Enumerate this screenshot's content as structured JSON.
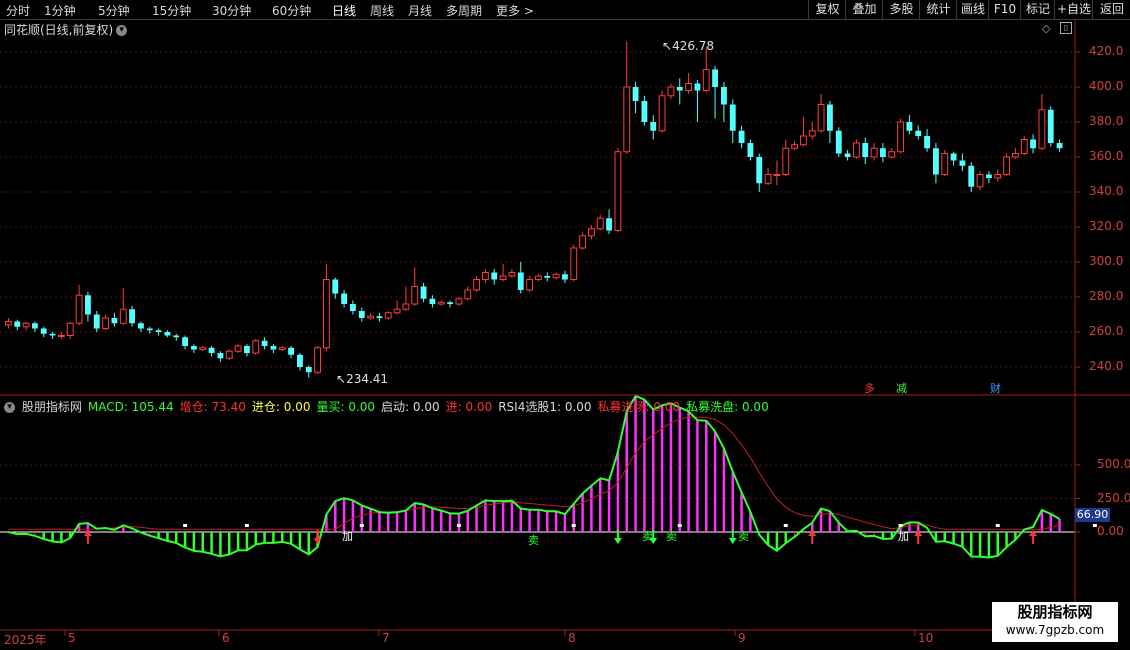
{
  "toolbar": {
    "left": [
      "分时",
      "1分钟",
      "5分钟",
      "15分钟",
      "30分钟",
      "60分钟",
      "日线",
      "周线",
      "月线",
      "多周期",
      "更多"
    ],
    "active": "日线",
    "right": [
      "复权",
      "叠加",
      "多股",
      "统计",
      "画线",
      "F10",
      "标记",
      "+自选",
      "返回"
    ]
  },
  "kchart": {
    "title": "同花顺(日线,前复权)",
    "high_label": "426.78",
    "low_label": "234.41",
    "y_ticks": [
      "420.0",
      "400.0",
      "380.0",
      "360.0",
      "340.0",
      "320.0",
      "300.0",
      "280.0",
      "260.0",
      "240.0"
    ],
    "tags": [
      {
        "text": "多",
        "color": "#ff3030"
      },
      {
        "text": "减",
        "color": "#30ff30"
      },
      {
        "text": "财",
        "color": "#30a0ff"
      }
    ],
    "candles": [
      [
        264,
        266,
        262,
        268
      ],
      [
        266,
        263,
        261,
        267
      ],
      [
        263,
        265,
        261,
        266
      ],
      [
        265,
        262,
        260,
        266
      ],
      [
        262,
        259,
        257,
        263
      ],
      [
        259,
        258,
        256,
        260
      ],
      [
        258,
        258,
        256,
        260
      ],
      [
        258,
        265,
        256,
        266
      ],
      [
        265,
        281,
        264,
        287
      ],
      [
        281,
        270,
        266,
        283
      ],
      [
        270,
        262,
        260,
        272
      ],
      [
        262,
        268,
        261,
        270
      ],
      [
        268,
        265,
        263,
        271
      ],
      [
        265,
        273,
        264,
        285
      ],
      [
        273,
        265,
        263,
        275
      ],
      [
        265,
        262,
        260,
        266
      ],
      [
        262,
        261,
        259,
        263
      ],
      [
        261,
        260,
        258,
        262
      ],
      [
        260,
        258,
        257,
        261
      ],
      [
        258,
        257,
        255,
        259
      ],
      [
        257,
        252,
        250,
        258
      ],
      [
        252,
        250,
        248,
        253
      ],
      [
        250,
        251,
        249,
        252
      ],
      [
        251,
        248,
        246,
        252
      ],
      [
        248,
        245,
        243,
        249
      ],
      [
        245,
        249,
        244,
        250
      ],
      [
        249,
        252,
        248,
        253
      ],
      [
        252,
        248,
        246,
        253
      ],
      [
        248,
        255,
        247,
        256
      ],
      [
        255,
        252,
        250,
        257
      ],
      [
        252,
        250,
        248,
        253
      ],
      [
        250,
        251,
        249,
        252
      ],
      [
        251,
        247,
        245,
        252
      ],
      [
        247,
        240,
        238,
        248
      ],
      [
        240,
        237,
        234,
        241
      ],
      [
        237,
        251,
        236,
        252
      ],
      [
        251,
        290,
        249,
        299
      ],
      [
        290,
        282,
        279,
        291
      ],
      [
        282,
        276,
        274,
        284
      ],
      [
        276,
        272,
        270,
        278
      ],
      [
        272,
        268,
        266,
        274
      ],
      [
        268,
        269,
        267,
        271
      ],
      [
        269,
        268,
        266,
        271
      ],
      [
        268,
        271,
        267,
        272
      ],
      [
        271,
        273,
        270,
        278
      ],
      [
        273,
        276,
        272,
        286
      ],
      [
        276,
        286,
        275,
        297
      ],
      [
        286,
        279,
        277,
        288
      ],
      [
        279,
        276,
        274,
        281
      ],
      [
        276,
        277,
        275,
        278
      ],
      [
        277,
        276,
        274,
        278
      ],
      [
        276,
        279,
        275,
        280
      ],
      [
        279,
        284,
        278,
        286
      ],
      [
        284,
        290,
        283,
        292
      ],
      [
        290,
        294,
        288,
        296
      ],
      [
        294,
        290,
        287,
        296
      ],
      [
        290,
        292,
        289,
        299
      ],
      [
        292,
        294,
        291,
        296
      ],
      [
        294,
        284,
        282,
        300
      ],
      [
        284,
        290,
        283,
        292
      ],
      [
        290,
        292,
        289,
        293
      ],
      [
        292,
        291,
        289,
        294
      ],
      [
        291,
        293,
        290,
        294
      ],
      [
        293,
        290,
        288,
        295
      ],
      [
        290,
        308,
        289,
        310
      ],
      [
        308,
        315,
        307,
        317
      ],
      [
        315,
        319,
        313,
        321
      ],
      [
        319,
        325,
        318,
        327
      ],
      [
        325,
        318,
        316,
        330
      ],
      [
        318,
        363,
        317,
        365
      ],
      [
        363,
        400,
        362,
        426
      ],
      [
        400,
        392,
        385,
        403
      ],
      [
        392,
        380,
        378,
        395
      ],
      [
        380,
        375,
        370,
        384
      ],
      [
        375,
        395,
        374,
        398
      ],
      [
        395,
        400,
        393,
        402
      ],
      [
        400,
        398,
        390,
        405
      ],
      [
        398,
        402,
        396,
        408
      ],
      [
        402,
        398,
        380,
        404
      ],
      [
        398,
        410,
        397,
        423
      ],
      [
        410,
        400,
        382,
        412
      ],
      [
        400,
        390,
        380,
        403
      ],
      [
        390,
        375,
        368,
        393
      ],
      [
        375,
        368,
        365,
        378
      ],
      [
        368,
        360,
        358,
        370
      ],
      [
        360,
        345,
        340,
        362
      ],
      [
        345,
        350,
        344,
        354
      ],
      [
        350,
        350,
        344,
        358
      ],
      [
        350,
        365,
        349,
        370
      ],
      [
        365,
        367,
        364,
        369
      ],
      [
        367,
        372,
        366,
        383
      ],
      [
        372,
        375,
        370,
        380
      ],
      [
        375,
        390,
        374,
        396
      ],
      [
        390,
        375,
        368,
        392
      ],
      [
        375,
        362,
        360,
        377
      ],
      [
        362,
        360,
        358,
        364
      ],
      [
        360,
        368,
        359,
        370
      ],
      [
        368,
        360,
        356,
        371
      ],
      [
        360,
        365,
        358,
        368
      ],
      [
        365,
        360,
        357,
        368
      ],
      [
        360,
        363,
        359,
        365
      ],
      [
        363,
        380,
        362,
        382
      ],
      [
        380,
        375,
        373,
        384
      ],
      [
        375,
        372,
        370,
        378
      ],
      [
        372,
        365,
        363,
        376
      ],
      [
        365,
        350,
        345,
        368
      ],
      [
        350,
        362,
        349,
        364
      ],
      [
        362,
        358,
        355,
        363
      ],
      [
        358,
        355,
        352,
        362
      ],
      [
        355,
        343,
        340,
        357
      ],
      [
        343,
        350,
        341,
        352
      ],
      [
        350,
        348,
        345,
        352
      ],
      [
        348,
        350,
        346,
        353
      ],
      [
        350,
        360,
        349,
        362
      ],
      [
        360,
        362,
        359,
        365
      ],
      [
        362,
        370,
        361,
        372
      ],
      [
        370,
        365,
        362,
        373
      ],
      [
        365,
        387,
        364,
        396
      ],
      [
        387,
        368,
        366,
        389
      ],
      [
        368,
        365,
        363,
        370
      ]
    ]
  },
  "indicator": {
    "items": [
      {
        "text": "股朋指标网",
        "color": "#d8d8d8"
      },
      {
        "text": "MACD: 105.44",
        "color": "#30ff30"
      },
      {
        "text": "增仓: 73.40",
        "color": "#ff3030"
      },
      {
        "text": "进仓: 0.00",
        "color": "#ffff40"
      },
      {
        "text": "量买: 0.00",
        "color": "#30ff30"
      },
      {
        "text": "启动: 0.00",
        "color": "#d8d8d8"
      },
      {
        "text": "进: 0.00",
        "color": "#ff3030"
      },
      {
        "text": "RSI4选股1: 0.00",
        "color": "#d8d8d8"
      },
      {
        "text": "私募进场: 0.00",
        "color": "#ff3030"
      },
      {
        "text": "私募洗盘: 0.00",
        "color": "#30ff30"
      }
    ],
    "y_ticks": [
      "500.0",
      "250.0",
      "0.00"
    ],
    "current": "66.90",
    "signal_labels": [
      {
        "text": "加",
        "color": "#ffffff"
      },
      {
        "text": "卖",
        "color": "#30ff30"
      },
      {
        "text": "卖",
        "color": "#30ff30"
      },
      {
        "text": "卖",
        "color": "#30ff30"
      },
      {
        "text": "卖",
        "color": "#30ff30"
      },
      {
        "text": "加",
        "color": "#ffffff"
      }
    ]
  },
  "dates": [
    "2025年",
    "5",
    "6",
    "7",
    "8",
    "9",
    "10"
  ],
  "watermark": {
    "line1": "股朋指标网",
    "line2": "www.7gpzb.com"
  }
}
